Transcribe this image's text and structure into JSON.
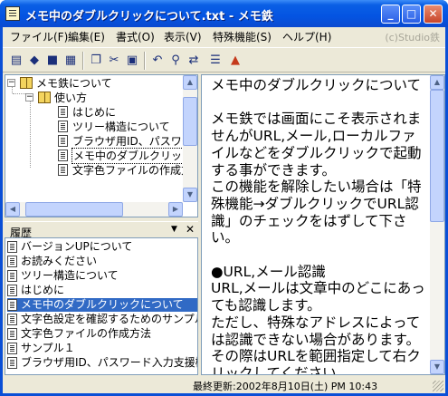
{
  "window": {
    "title": "メモ中のダブルクリックについて.txt - メモ鉄"
  },
  "titlebar_buttons": {
    "minimize": "_",
    "maximize": "□",
    "close": "✕"
  },
  "menu": {
    "items": [
      "ファイル(F)",
      "編集(E)",
      "書式(O)",
      "表示(V)",
      "特殊機能(S)",
      "ヘルプ(H)"
    ],
    "copyright": "(c)Studio鉄"
  },
  "toolbar": {
    "icons": [
      "new-document-icon",
      "open-book-icon",
      "save-icon",
      "print-icon",
      "copy-icon",
      "cut-icon",
      "paste-icon",
      "undo-icon",
      "find-icon",
      "replace-icon",
      "list-view-icon",
      "special-function-icon"
    ]
  },
  "tree": {
    "items": [
      {
        "label": "メモ鉄について",
        "level": 0,
        "expander": "−"
      },
      {
        "label": "使い方",
        "level": 1,
        "expander": "−"
      },
      {
        "label": "はじめに",
        "level": 2
      },
      {
        "label": "ツリー構造について",
        "level": 2
      },
      {
        "label": "ブラウザ用ID、パスワード",
        "level": 2
      },
      {
        "label": "メモ中のダブルクリックI",
        "level": 2,
        "selected": true
      },
      {
        "label": "文字色ファイルの作成方",
        "level": 2
      }
    ]
  },
  "history": {
    "title": "履歴",
    "dropdown": "▼",
    "close": "✕",
    "items": [
      {
        "label": "バージョンUPについて"
      },
      {
        "label": "お読みください"
      },
      {
        "label": "ツリー構造について"
      },
      {
        "label": "はじめに"
      },
      {
        "label": "メモ中のダブルクリックについて",
        "selected": true
      },
      {
        "label": "文字色設定を確認するためのサンプル"
      },
      {
        "label": "文字色ファイルの作成方法"
      },
      {
        "label": "サンプル１"
      },
      {
        "label": "ブラウザ用ID、パスワード入力支援機能"
      }
    ]
  },
  "editor": {
    "text": "メモ中のダブルクリックについて\n\nメモ鉄では画面にこそ表示されませんがURL,メール,ローカルファイルなどをダブルクリックで起動する事ができます。\nこの機能を解除したい場合は「特殊機能→ダブルクリックでURL認識」のチェックをはずして下さい。\n\n●URL,メール認識\nURL,メールは文章中のどこにあっても認識します。\nただし、特殊なアドレスによっては認識できない場合があります。\nその際はURLを範囲指定して右クリックしてください。"
  },
  "status": {
    "text": "最終更新:2002年8月10日(土) PM 10:43"
  },
  "colors": {
    "title_bar": "#0454e2",
    "selection": "#316ac5",
    "face": "#ece9d8"
  }
}
